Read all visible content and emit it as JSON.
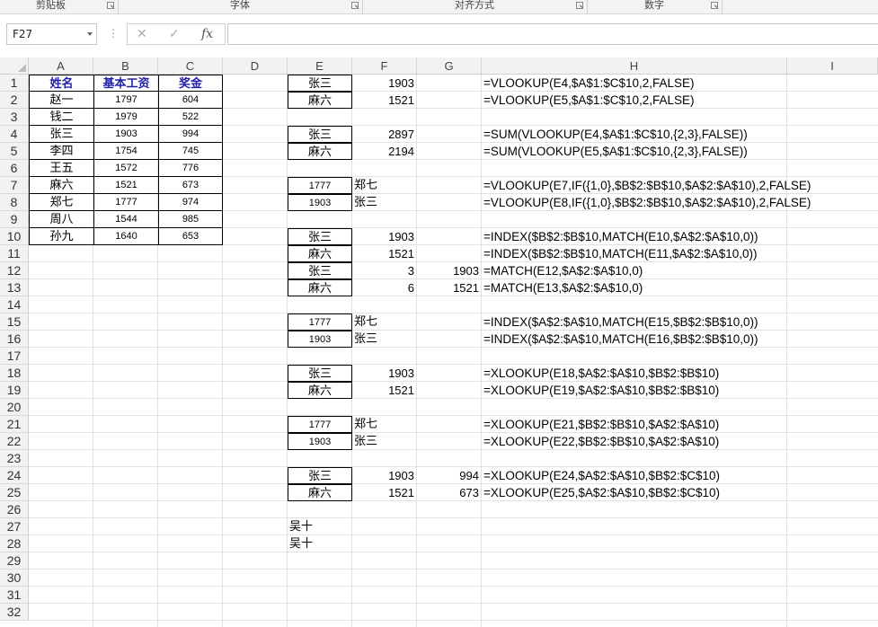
{
  "ribbon": {
    "groups": [
      "剪贴板",
      "字体",
      "对齐方式",
      "数字"
    ]
  },
  "formula_bar": {
    "name_box": "F27",
    "cancel_icon": "✕",
    "enter_icon": "✓",
    "fx_icon": "fx",
    "formula": ""
  },
  "columns": [
    "A",
    "B",
    "C",
    "D",
    "E",
    "F",
    "G",
    "H",
    "I"
  ],
  "rows": [
    "1",
    "2",
    "3",
    "4",
    "5",
    "6",
    "7",
    "8",
    "9",
    "10",
    "11",
    "12",
    "13",
    "14",
    "15",
    "16",
    "17",
    "18",
    "19",
    "20",
    "21",
    "22",
    "23",
    "24",
    "25",
    "26",
    "27",
    "28",
    "29",
    "30",
    "31",
    "32"
  ],
  "table": {
    "headers": [
      "姓名",
      "基本工资",
      "奖金"
    ],
    "rows": [
      [
        "赵一",
        "1797",
        "604"
      ],
      [
        "钱二",
        "1979",
        "522"
      ],
      [
        "张三",
        "1903",
        "994"
      ],
      [
        "李四",
        "1754",
        "745"
      ],
      [
        "王五",
        "1572",
        "776"
      ],
      [
        "麻六",
        "1521",
        "673"
      ],
      [
        "郑七",
        "1777",
        "974"
      ],
      [
        "周八",
        "1544",
        "985"
      ],
      [
        "孙九",
        "1640",
        "653"
      ]
    ]
  },
  "lookups": [
    {
      "row": 1,
      "e": "张三",
      "f": "1903",
      "g": "",
      "h": "=VLOOKUP(E4,$A$1:$C$10,2,FALSE)"
    },
    {
      "row": 2,
      "e": "麻六",
      "f": "1521",
      "g": "",
      "h": "=VLOOKUP(E5,$A$1:$C$10,2,FALSE)"
    },
    {
      "row": 4,
      "e": "张三",
      "f": "2897",
      "g": "",
      "h": "=SUM(VLOOKUP(E4,$A$1:$C$10,{2,3},FALSE))"
    },
    {
      "row": 5,
      "e": "麻六",
      "f": "2194",
      "g": "",
      "h": "=SUM(VLOOKUP(E5,$A$1:$C$10,{2,3},FALSE))"
    },
    {
      "row": 7,
      "e": "1777",
      "f": "郑七",
      "g": "",
      "h": "=VLOOKUP(E7,IF({1,0},$B$2:$B$10,$A$2:$A$10),2,FALSE)"
    },
    {
      "row": 8,
      "e": "1903",
      "f": "张三",
      "g": "",
      "h": "=VLOOKUP(E8,IF({1,0},$B$2:$B$10,$A$2:$A$10),2,FALSE)"
    },
    {
      "row": 10,
      "e": "张三",
      "f": "1903",
      "g": "",
      "h": "=INDEX($B$2:$B$10,MATCH(E10,$A$2:$A$10,0))"
    },
    {
      "row": 11,
      "e": "麻六",
      "f": "1521",
      "g": "",
      "h": "=INDEX($B$2:$B$10,MATCH(E11,$A$2:$A$10,0))"
    },
    {
      "row": 12,
      "e": "张三",
      "f": "3",
      "g": "1903",
      "h": "=MATCH(E12,$A$2:$A$10,0)"
    },
    {
      "row": 13,
      "e": "麻六",
      "f": "6",
      "g": "1521",
      "h": "=MATCH(E13,$A$2:$A$10,0)"
    },
    {
      "row": 15,
      "e": "1777",
      "f": "郑七",
      "g": "",
      "h": "=INDEX($A$2:$A$10,MATCH(E15,$B$2:$B$10,0))"
    },
    {
      "row": 16,
      "e": "1903",
      "f": "张三",
      "g": "",
      "h": "=INDEX($A$2:$A$10,MATCH(E16,$B$2:$B$10,0))"
    },
    {
      "row": 18,
      "e": "张三",
      "f": "1903",
      "g": "",
      "h": "=XLOOKUP(E18,$A$2:$A$10,$B$2:$B$10)"
    },
    {
      "row": 19,
      "e": "麻六",
      "f": "1521",
      "g": "",
      "h": "=XLOOKUP(E19,$A$2:$A$10,$B$2:$B$10)"
    },
    {
      "row": 21,
      "e": "1777",
      "f": "郑七",
      "g": "",
      "h": "=XLOOKUP(E21,$B$2:$B$10,$A$2:$A$10)"
    },
    {
      "row": 22,
      "e": "1903",
      "f": "张三",
      "g": "",
      "h": "=XLOOKUP(E22,$B$2:$B$10,$A$2:$A$10)"
    },
    {
      "row": 24,
      "e": "张三",
      "f": "1903",
      "g": "994",
      "h": "=XLOOKUP(E24,$A$2:$A$10,$B$2:$C$10)"
    },
    {
      "row": 25,
      "e": "麻六",
      "f": "1521",
      "g": "673",
      "h": "=XLOOKUP(E25,$A$2:$A$10,$B$2:$C$10)"
    }
  ],
  "extra_cells": [
    {
      "row": 27,
      "text": "吴十"
    },
    {
      "row": 28,
      "text": "吴十"
    }
  ]
}
